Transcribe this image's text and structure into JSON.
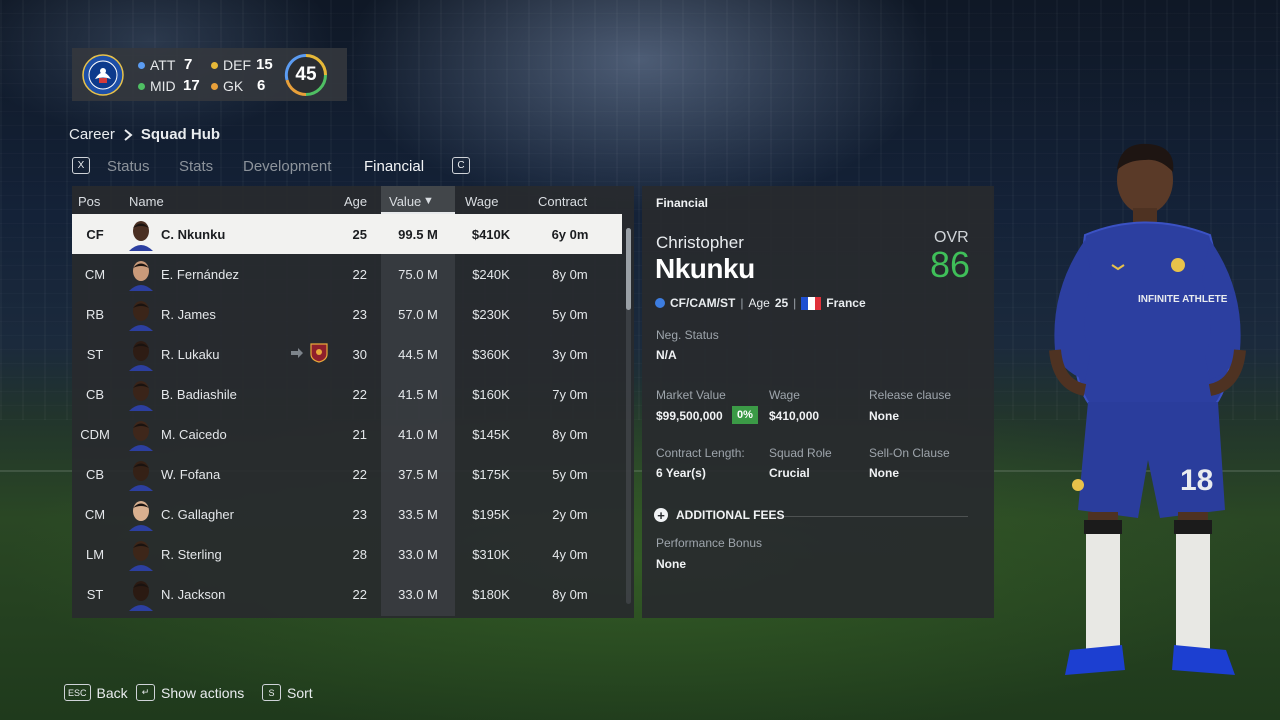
{
  "club": {
    "name": "Chelsea",
    "stats": [
      {
        "label": "ATT",
        "value": "7",
        "color": "#5b9cf2"
      },
      {
        "label": "DEF",
        "value": "15",
        "color": "#e6b838"
      },
      {
        "label": "MID",
        "value": "17",
        "color": "#4fbf63"
      },
      {
        "label": "GK",
        "value": "6",
        "color": "#e8a03a"
      }
    ],
    "overall": "45"
  },
  "breadcrumb": {
    "root": "Career",
    "current": "Squad Hub"
  },
  "tabs": {
    "left_key": "X",
    "right_key": "C",
    "items": [
      "Status",
      "Stats",
      "Development",
      "Financial"
    ],
    "active": "Financial"
  },
  "table": {
    "headers": {
      "pos": "Pos",
      "name": "Name",
      "age": "Age",
      "value": "Value",
      "wage": "Wage",
      "contract": "Contract"
    },
    "sort_indicator": "▼",
    "rows": [
      {
        "pos": "CF",
        "name": "C. Nkunku",
        "age": "25",
        "value": "99.5 M",
        "wage": "$410K",
        "contract": "6y 0m"
      },
      {
        "pos": "CM",
        "name": "E. Fernández",
        "age": "22",
        "value": "75.0 M",
        "wage": "$240K",
        "contract": "8y 0m"
      },
      {
        "pos": "RB",
        "name": "R. James",
        "age": "23",
        "value": "57.0 M",
        "wage": "$230K",
        "contract": "5y 0m"
      },
      {
        "pos": "ST",
        "name": "R. Lukaku",
        "age": "30",
        "value": "44.5 M",
        "wage": "$360K",
        "contract": "3y 0m"
      },
      {
        "pos": "CB",
        "name": "B. Badiashile",
        "age": "22",
        "value": "41.5 M",
        "wage": "$160K",
        "contract": "7y 0m"
      },
      {
        "pos": "CDM",
        "name": "M. Caicedo",
        "age": "21",
        "value": "41.0 M",
        "wage": "$145K",
        "contract": "8y 0m"
      },
      {
        "pos": "CB",
        "name": "W. Fofana",
        "age": "22",
        "value": "37.5 M",
        "wage": "$175K",
        "contract": "5y 0m"
      },
      {
        "pos": "CM",
        "name": "C. Gallagher",
        "age": "23",
        "value": "33.5 M",
        "wage": "$195K",
        "contract": "2y 0m"
      },
      {
        "pos": "LM",
        "name": "R. Sterling",
        "age": "28",
        "value": "33.0 M",
        "wage": "$310K",
        "contract": "4y 0m"
      },
      {
        "pos": "ST",
        "name": "N. Jackson",
        "age": "22",
        "value": "33.0 M",
        "wage": "$180K",
        "contract": "8y 0m"
      }
    ]
  },
  "detail": {
    "header": "Financial",
    "first_name": "Christopher",
    "last_name": "Nkunku",
    "ovr_label": "OVR",
    "ovr": "86",
    "positions": "CF/CAM/ST",
    "age_label": "Age",
    "age": "25",
    "nation": "France",
    "neg_status_label": "Neg. Status",
    "neg_status": "N/A",
    "market_value_label": "Market Value",
    "market_value": "$99,500,000",
    "market_value_change": "0%",
    "wage_label": "Wage",
    "wage": "$410,000",
    "release_label": "Release clause",
    "release": "None",
    "contract_length_label": "Contract Length:",
    "contract_length": "6 Year(s)",
    "squad_role_label": "Squad Role",
    "squad_role": "Crucial",
    "sell_on_label": "Sell-On Clause",
    "sell_on": "None",
    "additional_fees": "ADDITIONAL FEES",
    "performance_bonus_label": "Performance Bonus",
    "performance_bonus": "None"
  },
  "player_model": {
    "shirt_text": "INFINITE ATHLETE",
    "number": "18"
  },
  "footer": [
    {
      "key": "ESC",
      "label": "Back"
    },
    {
      "key": "↵",
      "label": "Show actions"
    },
    {
      "key": "S",
      "label": "Sort"
    }
  ]
}
